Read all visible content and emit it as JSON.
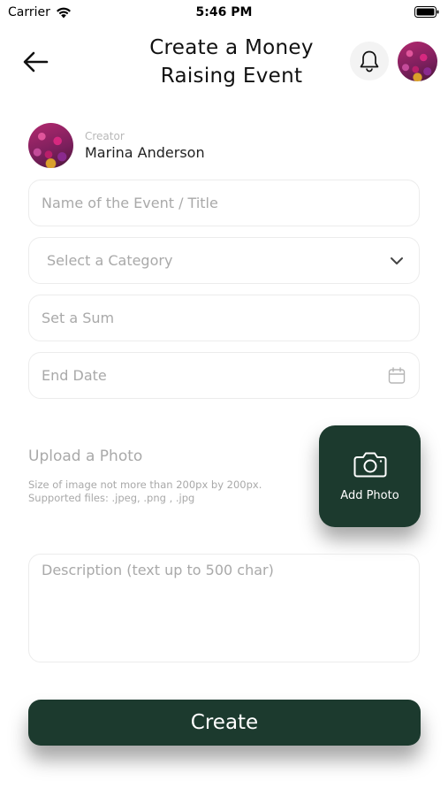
{
  "status_bar": {
    "carrier": "Carrier",
    "time": "5:46 PM"
  },
  "header": {
    "title_line1": "Create a Money",
    "title_line2": "Raising Event",
    "back_icon": "arrow-left-icon",
    "notification_icon": "bell-icon"
  },
  "creator": {
    "label": "Creator",
    "name": "Marina Anderson"
  },
  "form": {
    "title_placeholder": "Name of the Event / Title",
    "category_placeholder": "Select a Category",
    "sum_placeholder": "Set a Sum",
    "end_date_placeholder": "End Date"
  },
  "upload": {
    "title": "Upload a Photo",
    "hint_line1": "Size of image not more than 200px by 200px.",
    "hint_line2": "Supported files: .jpeg, .png , .jpg",
    "button_label": "Add Photo"
  },
  "description": {
    "placeholder": "Description (text up to 500 char)"
  },
  "actions": {
    "create_label": "Create"
  },
  "colors": {
    "primary": "#1c3a2e",
    "placeholder": "#a9a9a9",
    "border": "#ececec"
  }
}
